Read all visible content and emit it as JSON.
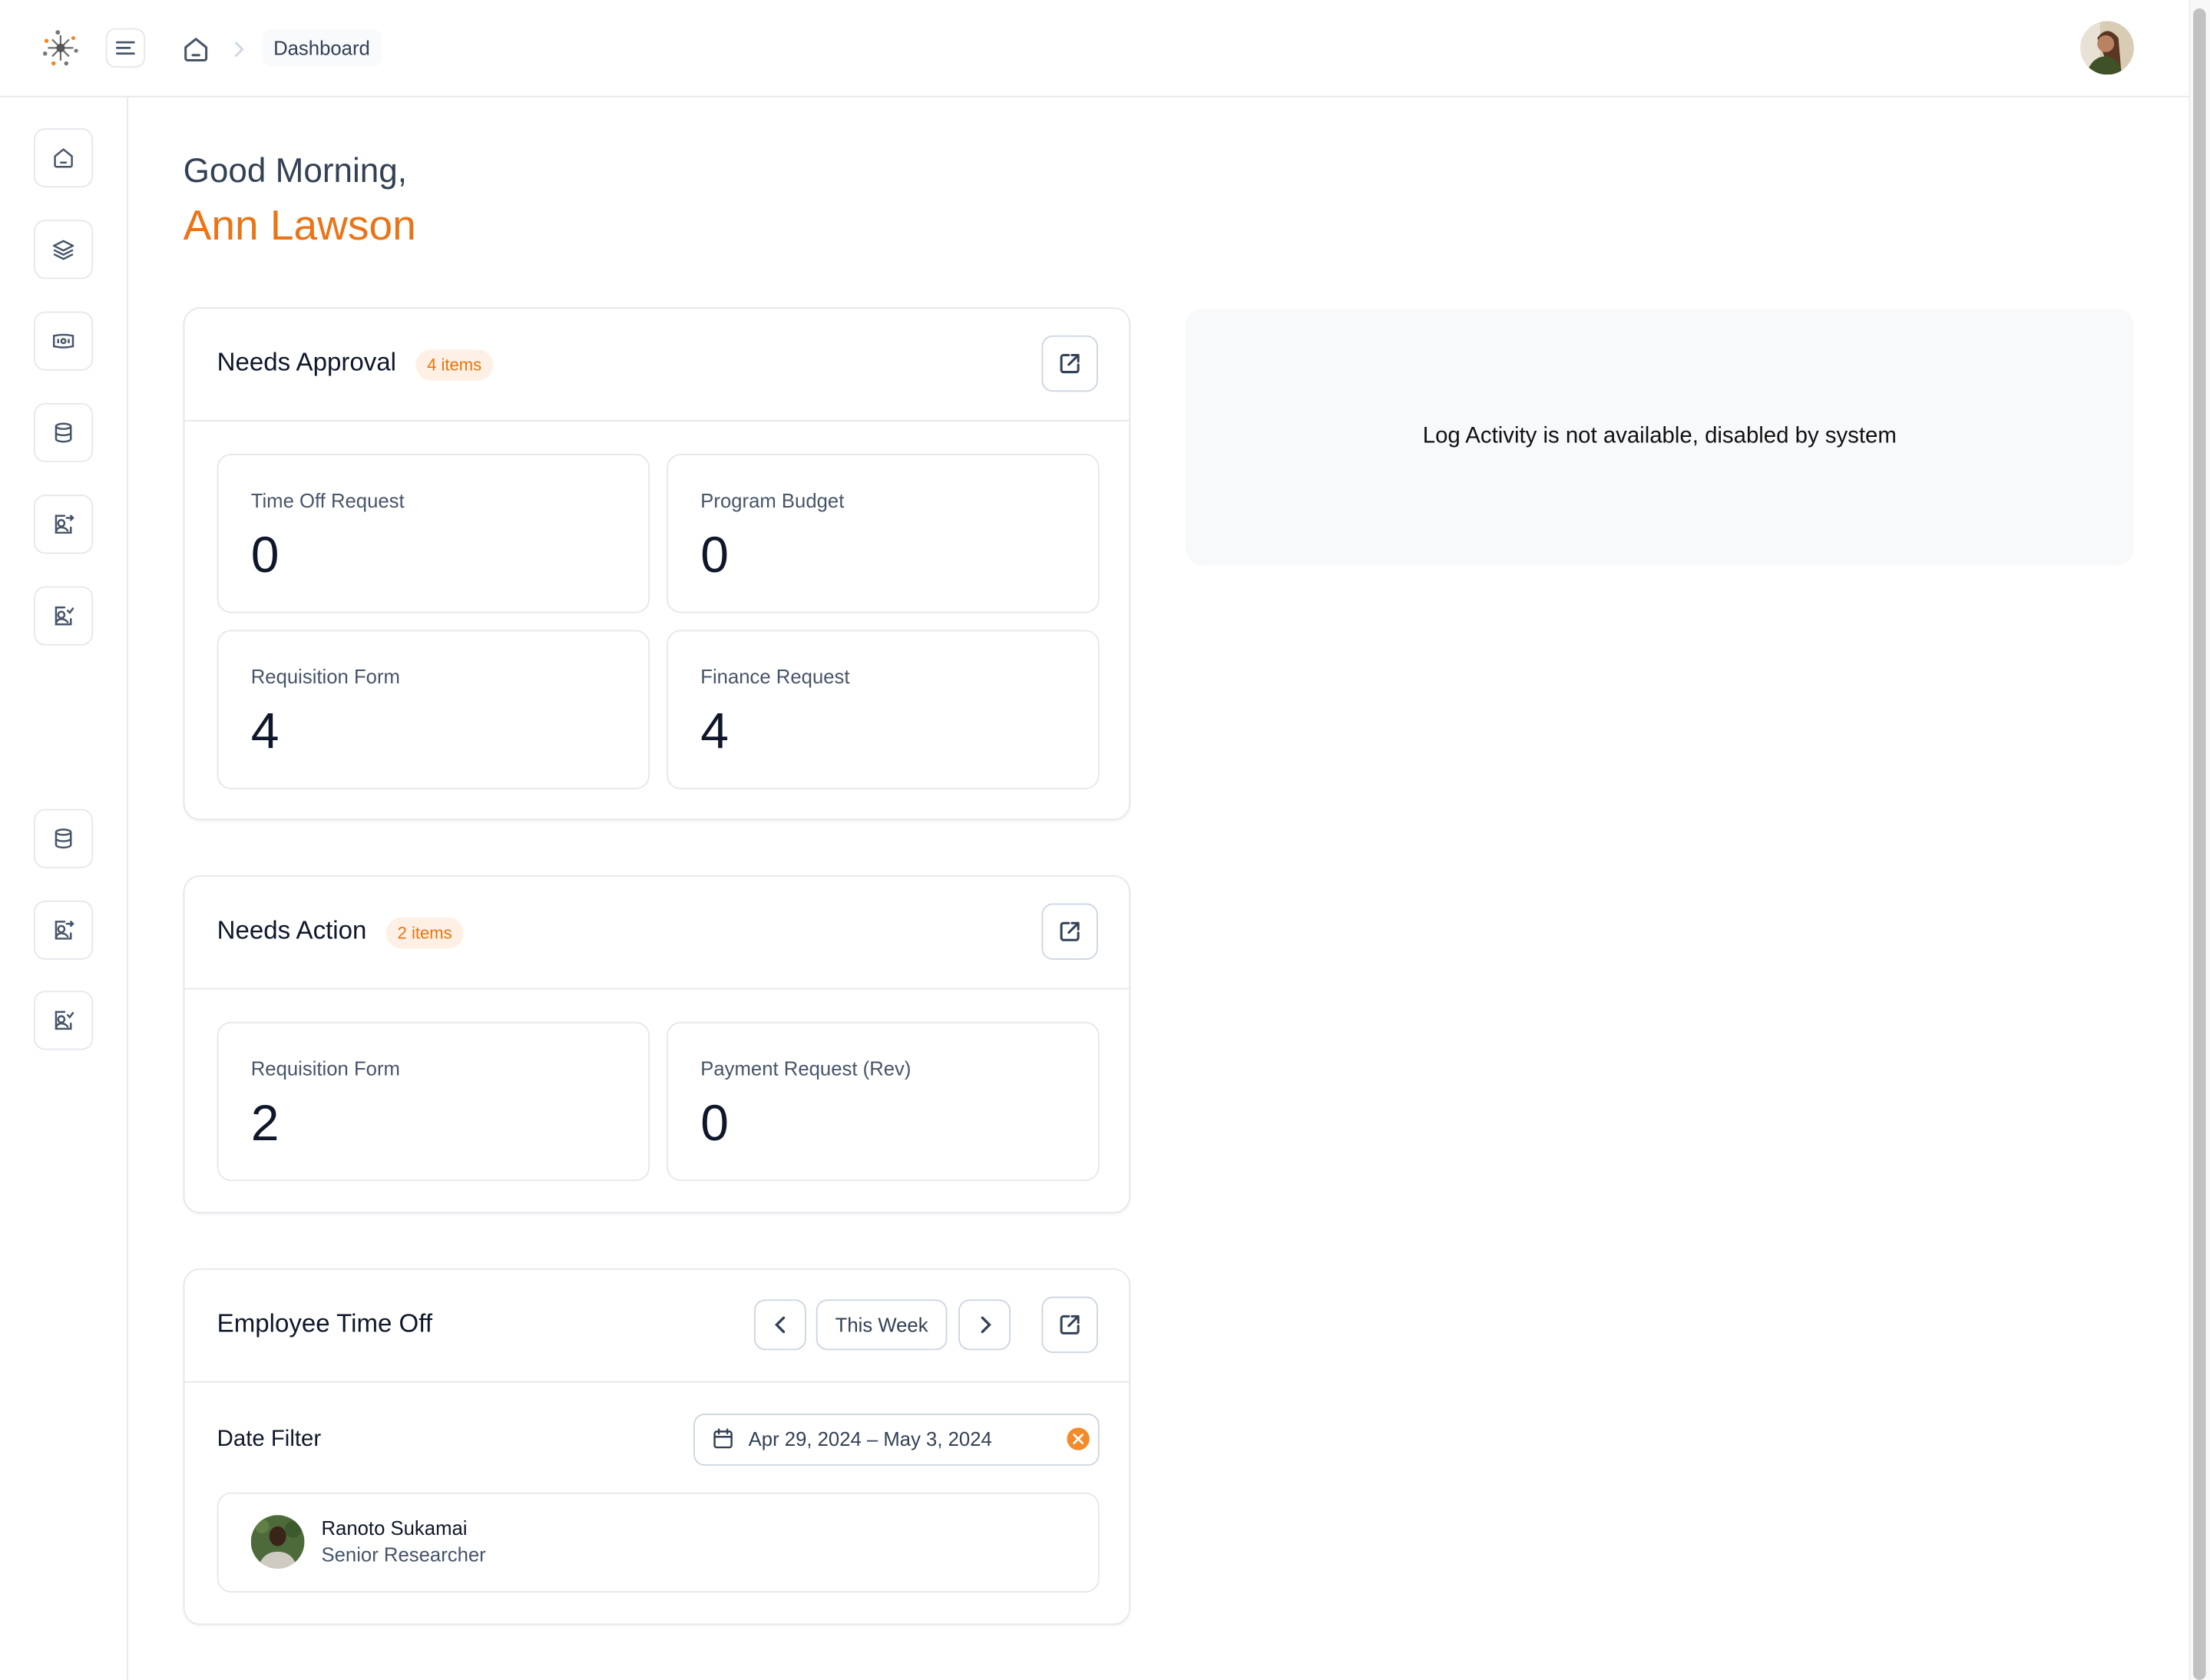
{
  "header": {
    "breadcrumb": {
      "home_icon": "home-icon",
      "current": "Dashboard"
    },
    "menu_icon": "menu-icon",
    "avatar": "user-avatar"
  },
  "sidebar": {
    "items": [
      {
        "icon": "home-icon"
      },
      {
        "icon": "layers-icon"
      },
      {
        "icon": "banknote-icon"
      },
      {
        "icon": "database-icon"
      },
      {
        "icon": "user-forward-icon"
      },
      {
        "icon": "user-check-icon"
      },
      {
        "icon": "database-icon"
      },
      {
        "icon": "user-forward-icon"
      },
      {
        "icon": "user-check-icon"
      }
    ]
  },
  "greeting": {
    "line1": "Good Morning,",
    "name": "Ann Lawson"
  },
  "needs_approval": {
    "title": "Needs Approval",
    "badge": "4 items",
    "stats": [
      {
        "label": "Time Off Request",
        "value": "0"
      },
      {
        "label": "Program Budget",
        "value": "0"
      },
      {
        "label": "Requisition Form",
        "value": "4"
      },
      {
        "label": "Finance Request",
        "value": "4"
      }
    ]
  },
  "needs_action": {
    "title": "Needs Action",
    "badge": "2 items",
    "stats": [
      {
        "label": "Requisition Form",
        "value": "2"
      },
      {
        "label": "Payment Request (Rev)",
        "value": "0"
      }
    ]
  },
  "employee_time_off": {
    "title": "Employee Time Off",
    "period_label": "This Week",
    "date_filter_label": "Date Filter",
    "date_range": "Apr 29, 2024 – May 3, 2024",
    "employees": [
      {
        "name": "Ranoto Sukamai",
        "role": "Senior Researcher"
      }
    ]
  },
  "log_activity": {
    "message": "Log Activity is not available, disabled by system"
  },
  "colors": {
    "accent": "#ea7417",
    "badge_bg": "#fef0e4",
    "clear_icon": "#f58a2a"
  }
}
